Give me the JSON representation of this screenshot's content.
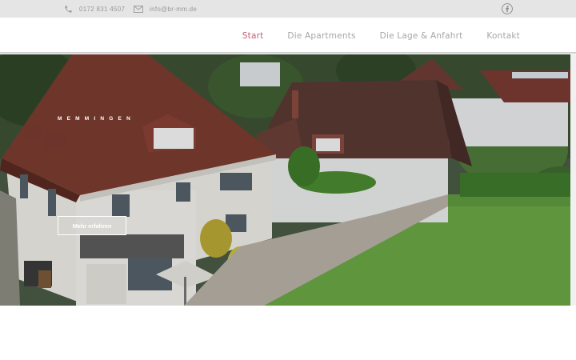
{
  "topbar": {
    "phone": "0172 831 4507",
    "email": "info@br-mm.de",
    "phone_icon": "phone-icon",
    "email_icon": "envelope-icon",
    "social_icon": "facebook-icon"
  },
  "nav": {
    "items": [
      {
        "label": "Start",
        "active": true
      },
      {
        "label": "Die Apartments",
        "active": false
      },
      {
        "label": "Die Lage & Anfahrt",
        "active": false
      },
      {
        "label": "Kontakt",
        "active": false
      }
    ]
  },
  "hero": {
    "city": "MEMMINGEN",
    "cta_label": "Mehr erfahren"
  },
  "colors": {
    "topbar_bg": "#e5e5e5",
    "nav_active": "#c2606e",
    "nav_text": "#a6a6a6"
  }
}
